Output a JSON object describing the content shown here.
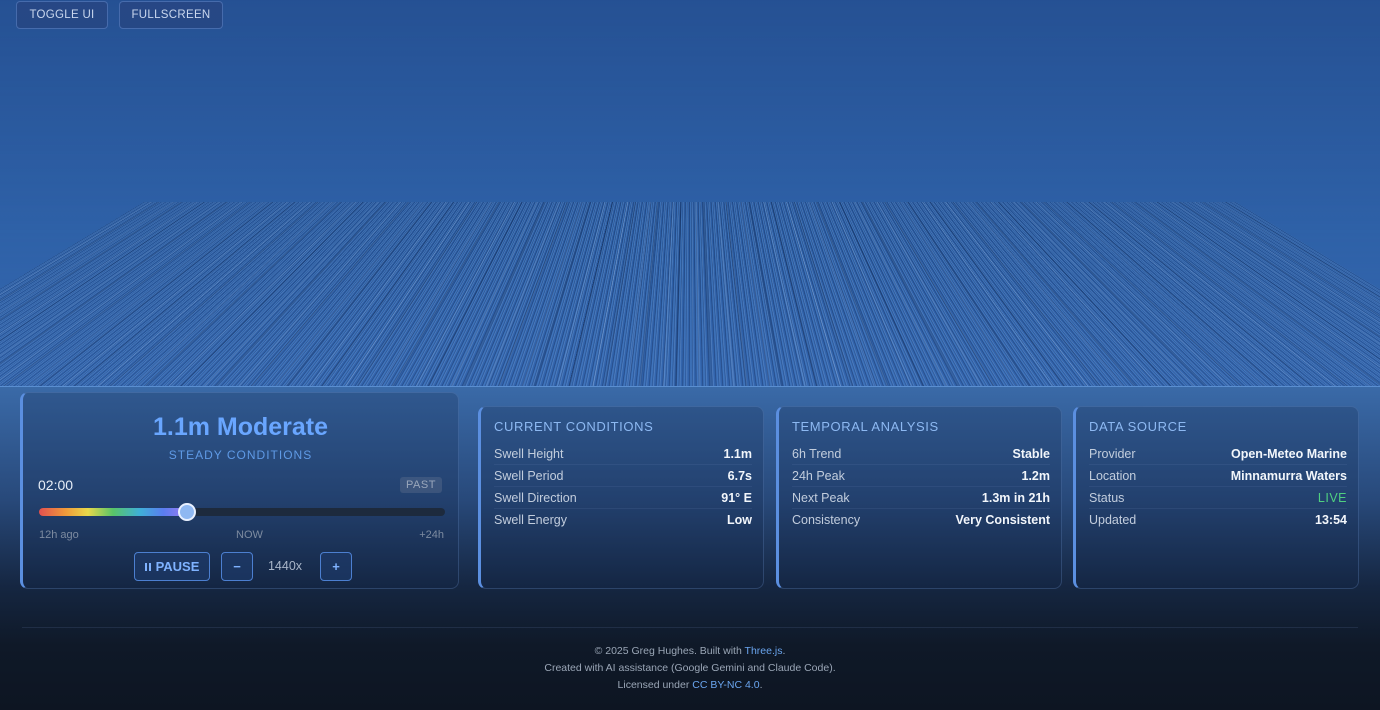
{
  "top_buttons": {
    "toggle_ui": "TOGGLE UI",
    "fullscreen": "FULLSCREEN"
  },
  "hero": {
    "title": "1.1m Moderate",
    "subtitle": "STEADY CONDITIONS",
    "time": "02:00",
    "badge": "PAST",
    "slider_position": 0.365,
    "tick_start": "12h ago",
    "tick_mid": "NOW",
    "tick_end": "+24h",
    "pause_label": "PAUSE",
    "minus_label": "−",
    "speed": "1440x",
    "plus_label": "+"
  },
  "current": {
    "title": "CURRENT CONDITIONS",
    "rows": [
      {
        "label": "Swell Height",
        "value": "1.1m"
      },
      {
        "label": "Swell Period",
        "value": "6.7s"
      },
      {
        "label": "Swell Direction",
        "value": "91° E"
      },
      {
        "label": "Swell Energy",
        "value": "Low"
      }
    ]
  },
  "temporal": {
    "title": "TEMPORAL ANALYSIS",
    "rows": [
      {
        "label": "6h Trend",
        "value": "Stable"
      },
      {
        "label": "24h Peak",
        "value": "1.2m"
      },
      {
        "label": "Next Peak",
        "value": "1.3m in 21h"
      },
      {
        "label": "Consistency",
        "value": "Very Consistent"
      }
    ]
  },
  "source": {
    "title": "DATA SOURCE",
    "rows": [
      {
        "label": "Provider",
        "value": "Open-Meteo Marine"
      },
      {
        "label": "Location",
        "value": "Minnamurra Waters"
      },
      {
        "label": "Status",
        "value": "LIVE"
      },
      {
        "label": "Updated",
        "value": "13:54"
      }
    ]
  },
  "footer": {
    "line1_prefix": "© 2025 Greg Hughes. Built with ",
    "line1_link": "Three.js",
    "line1_suffix": ".",
    "line2": "Created with AI assistance (Google Gemini and Claude Code).",
    "line3_prefix": "Licensed under ",
    "line3_link": "CC BY-NC 4.0",
    "line3_suffix": "."
  },
  "colors": {
    "accent": "#69a6ff",
    "live": "#4fcf80",
    "panel_border": "#5b8fe0"
  },
  "icons": {
    "pause": "pause-icon"
  }
}
